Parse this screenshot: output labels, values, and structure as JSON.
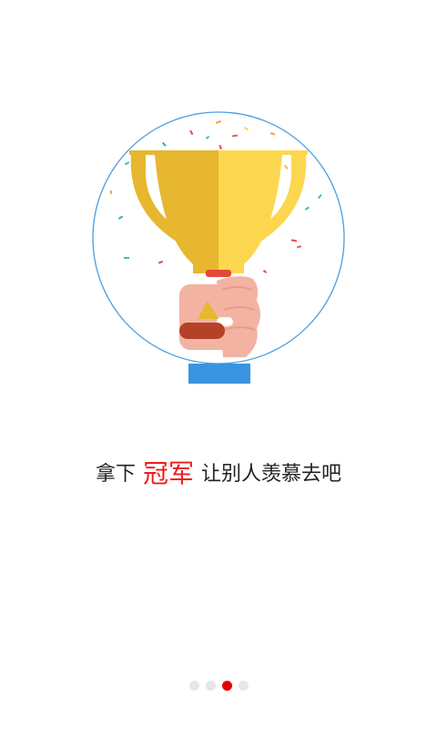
{
  "slogan": {
    "before": "拿下",
    "highlight": "冠军",
    "after": "让别人羡慕去吧"
  },
  "illustration": {
    "name": "trophy-in-hand",
    "colors": {
      "circle": "#4a9ee0",
      "cup_left": "#e6b72f",
      "cup_right": "#fdd64f",
      "hand": "#f2b3a3",
      "sleeve": "#3a95e0",
      "band": "#b54128"
    }
  },
  "pager": {
    "count": 4,
    "active_index": 2,
    "active_color": "#e40000",
    "inactive_color": "#e6e6e6"
  }
}
